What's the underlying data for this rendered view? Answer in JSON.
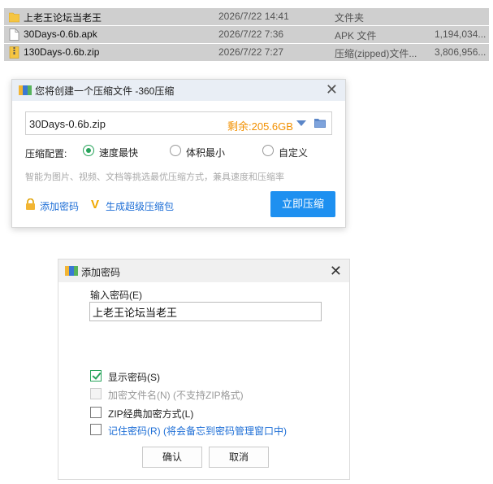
{
  "file_list": [
    {
      "name": "上老王论坛当老王",
      "date": "2026/7/22 14:41",
      "type": "文件夹",
      "size": "",
      "icon": "folder-icon"
    },
    {
      "name": "30Days-0.6b.apk",
      "date": "2026/7/22 7:36",
      "type": "APK 文件",
      "size": "1,194,034...",
      "icon": "file-icon"
    },
    {
      "name": "130Days-0.6b.zip",
      "date": "2026/7/22 7:27",
      "type": "压缩(zipped)文件...",
      "size": "3,806,956...",
      "icon": "zip-icon"
    }
  ],
  "compress_dialog": {
    "title": "您将创建一个压缩文件 -360压缩",
    "path_value": "30Days-0.6b.zip",
    "free_space": "剩余:205.6GB",
    "config_label": "压缩配置:",
    "options": [
      {
        "label": "速度最快",
        "selected": true
      },
      {
        "label": "体积最小",
        "selected": false
      },
      {
        "label": "自定义",
        "selected": false
      }
    ],
    "hint": "智能为图片、视频、文档等挑选最优压缩方式，兼具速度和压缩率",
    "add_password_link": "添加密码",
    "super_pack_link": "生成超级压缩包",
    "compress_button": "立即压缩",
    "accent_color": "#1e90f0",
    "free_space_color": "#f29000"
  },
  "password_dialog": {
    "title": "添加密码",
    "input_label": "输入密码(E)",
    "password_value": "上老王论坛当老王",
    "checkboxes": [
      {
        "label": "显示密码(S)",
        "checked": true,
        "disabled": false
      },
      {
        "label": "加密文件名(N) (不支持ZIP格式)",
        "checked": false,
        "disabled": true
      },
      {
        "label": "ZIP经典加密方式(L)",
        "checked": false,
        "disabled": false
      },
      {
        "label": "记住密码(R) (将会备忘到密码管理窗口中)",
        "checked": false,
        "disabled": false
      }
    ],
    "ok_button": "确认",
    "cancel_button": "取消"
  }
}
